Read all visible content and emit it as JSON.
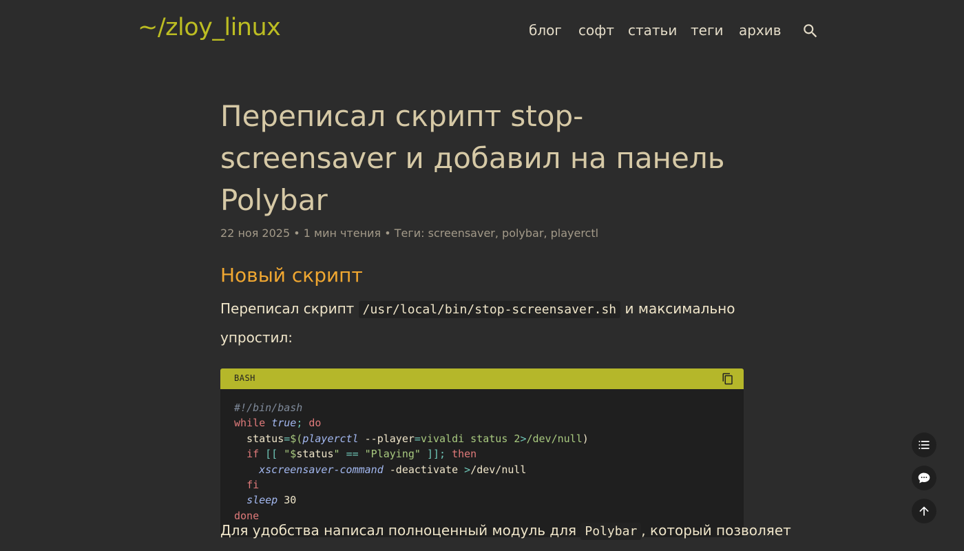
{
  "header": {
    "logo": "~/zloy_linux",
    "nav": [
      {
        "label": "блог"
      },
      {
        "label": "софт"
      },
      {
        "label": "статьи"
      },
      {
        "label": "теги"
      },
      {
        "label": "архив"
      }
    ],
    "search_icon": "search-icon"
  },
  "post": {
    "title": "Переписал скрипт stop-screensaver и добавил на панель Polybar",
    "meta": {
      "date": "22 ноя 2025",
      "sep1": " • ",
      "reading_time": "1 мин чтения",
      "sep2": " • ",
      "tags_label": "Теги: ",
      "tags": [
        "screensaver",
        "polybar",
        "playerctl"
      ],
      "tag_sep": ", "
    },
    "section_title": "Новый скрипт",
    "para1": {
      "before": "Переписал скрипт ",
      "code": "/usr/local/bin/stop-screensaver.sh",
      "after": " и максимально упростил:"
    },
    "code_block": {
      "language": "BASH",
      "copy_icon": "copy-icon"
    },
    "para2": {
      "before": "Для удобства написал полноценный модуль для ",
      "code": "Polybar",
      "after": ", который позволяет"
    }
  },
  "floating": {
    "toc_icon": "list-icon",
    "comments_icon": "comment-icon",
    "top_icon": "arrow-up-icon"
  },
  "colors": {
    "background": "#2c2c2c",
    "logo": "#bcbd22",
    "section_title": "#f0a731",
    "code_header": "#b5b72a"
  }
}
